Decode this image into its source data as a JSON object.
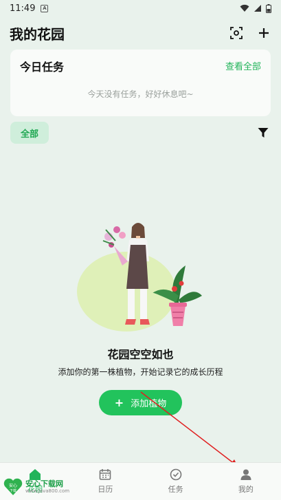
{
  "status_bar": {
    "time": "11:49",
    "sim_icon": "A"
  },
  "header": {
    "title": "我的花园",
    "scan_icon": "scan-icon",
    "add_icon": "plus-icon"
  },
  "today_tasks": {
    "title": "今日任务",
    "view_all": "查看全部",
    "empty_text": "今天没有任务，好好休息吧~"
  },
  "filter": {
    "chip_label": "全部",
    "filter_icon": "funnel-icon"
  },
  "empty_state": {
    "title": "花园空空如也",
    "subtitle": "添加你的第一株植物，开始记录它的成长历程",
    "add_button_plus": "+",
    "add_button_label": "添加植物"
  },
  "bottom_nav": {
    "items": [
      {
        "label": "花园",
        "icon": "home-icon",
        "active": true
      },
      {
        "label": "日历",
        "icon": "calendar-icon",
        "active": false
      },
      {
        "label": "任务",
        "icon": "check-circle-icon",
        "active": false
      },
      {
        "label": "我的",
        "icon": "person-icon",
        "active": false
      }
    ]
  },
  "watermark": {
    "main": "安心下载网",
    "sub": "www.Java800.com",
    "badge_top": "安心",
    "badge_bottom": "下载"
  },
  "colors": {
    "accent": "#22c35c",
    "background": "#e9f2ec",
    "card": "#f9fbf9",
    "annotation": "#e02020"
  }
}
